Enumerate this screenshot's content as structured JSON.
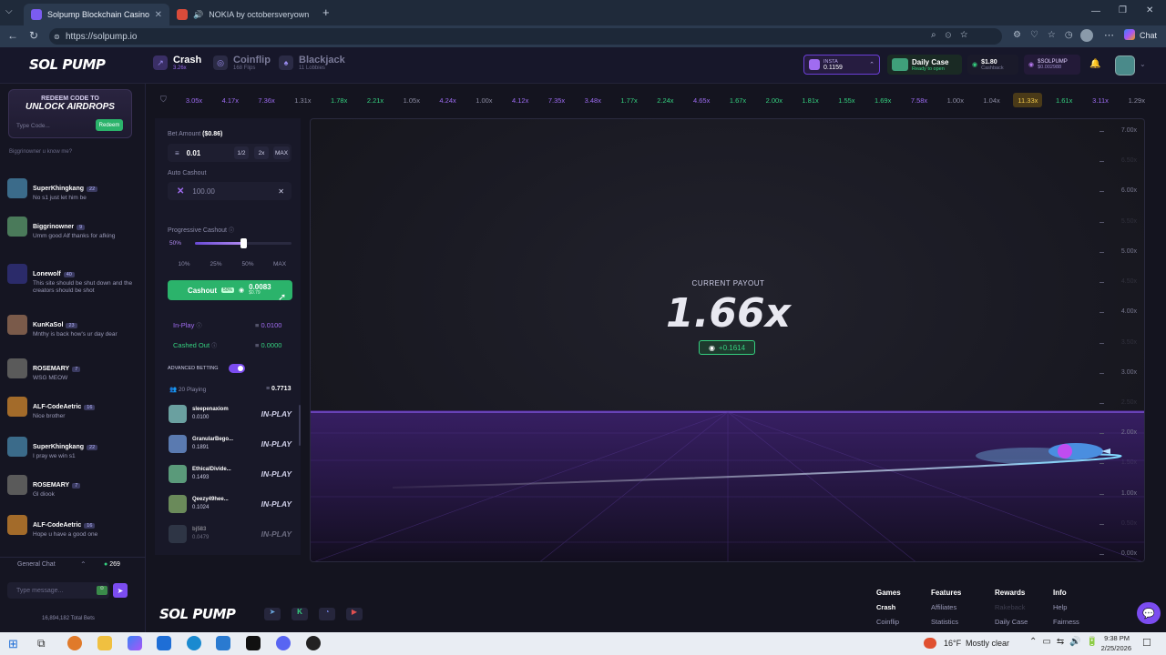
{
  "browser": {
    "tabs": [
      {
        "title": "Solpump Blockchain Casino | Sola",
        "active": true
      },
      {
        "title": "NOKIA by octobersveryown",
        "active": false
      }
    ],
    "new_tab": "+",
    "url": "https://solpump.io",
    "profile_label": "Chat"
  },
  "site": {
    "logo": "SOL PUMP",
    "games": [
      {
        "name": "Crash",
        "sub": "3.26x"
      },
      {
        "name": "Coinflip",
        "sub": "168 Flips"
      },
      {
        "name": "Blackjack",
        "sub": "11 Lobbies"
      }
    ],
    "header": {
      "insta_label": "INSTA",
      "insta_value": "0.1159",
      "daily_case_title": "Daily Case",
      "daily_case_sub": "Ready to open",
      "cashback_value": "$1.80",
      "cashback_label": "Cashback",
      "balance_label": "$SOLPUMP",
      "balance_value": "$0.002988"
    },
    "history": [
      "3.05x",
      "4.17x",
      "7.36x",
      "1.31x",
      "1.78x",
      "2.21x",
      "1.05x",
      "4.24x",
      "1.00x",
      "4.12x",
      "7.35x",
      "3.48x",
      "1.77x",
      "2.24x",
      "4.65x",
      "1.67x",
      "2.00x",
      "1.81x",
      "1.55x",
      "1.69x",
      "7.58x",
      "1.00x",
      "1.04x",
      "11.33x",
      "1.61x",
      "3.11x",
      "1.29x"
    ],
    "history_colors": [
      "#9d6cf2",
      "#9d6cf2",
      "#9d6cf2",
      "#8a8aa0",
      "#35d07f",
      "#35d07f",
      "#8a8aa0",
      "#9d6cf2",
      "#8a8aa0",
      "#9d6cf2",
      "#9d6cf2",
      "#9d6cf2",
      "#35d07f",
      "#35d07f",
      "#9d6cf2",
      "#35d07f",
      "#35d07f",
      "#35d07f",
      "#35d07f",
      "#35d07f",
      "#9d6cf2",
      "#8a8aa0",
      "#8a8aa0",
      "#f0c84a",
      "#35d07f",
      "#9d6cf2",
      "#8a8aa0"
    ]
  },
  "chat": {
    "redeem_title": "REDEEM CODE TO",
    "redeem_big": "UNLOCK AIRDROPS",
    "redeem_placeholder": "Type Code...",
    "redeem_button": "Redeem",
    "top_cut": "Biggrinowner u know me?",
    "messages": [
      {
        "name": "SuperKhingkang",
        "level": "22",
        "text": "No s1 just let him be",
        "color": "#3b6b8a"
      },
      {
        "name": "Biggrinowner",
        "level": "9",
        "text": "Umm good Alf thanks for afking",
        "color": "#4a7a5a"
      },
      {
        "name": "Lonewolf",
        "level": "40",
        "text": "This site should be shut down and the creators should be shot",
        "color": "#2b2b6a"
      },
      {
        "name": "KunKaSol",
        "level": "23",
        "text": "Mnthy is back how's ur day dear",
        "color": "#7a5a4a"
      },
      {
        "name": "ROSEMARY",
        "level": "7",
        "text": "WSG MEOW",
        "color": "#5a5a5a"
      },
      {
        "name": "ALF-CodeAetric",
        "level": "16",
        "text": "Nice brother",
        "color": "#a36b2a"
      },
      {
        "name": "SuperKhingkang",
        "level": "22",
        "text": "I pray we win s1",
        "color": "#3b6b8a"
      },
      {
        "name": "ROSEMARY",
        "level": "7",
        "text": "Gl diook",
        "color": "#5a5a5a"
      },
      {
        "name": "ALF-CodeAetric",
        "level": "16",
        "text": "Hope u have a good one",
        "color": "#a36b2a"
      }
    ],
    "channel": "General Chat",
    "online": "269",
    "input_placeholder": "Type message...",
    "total_bets": "16,894,182 Total Bets"
  },
  "bet": {
    "bet_amount_label": "Bet Amount",
    "bet_amount_usd": "($0.86)",
    "bet_amount": "0.01",
    "half": "1/2",
    "double": "2x",
    "max": "MAX",
    "auto_cashout_label": "Auto Cashout",
    "auto_cashout_value": "100.00",
    "progressive_label": "Progressive Cashout",
    "progressive_value": "50%",
    "progressive_fraction": 0.5,
    "presets": [
      "10%",
      "25%",
      "50%",
      "MAX"
    ],
    "cashout_label": "Cashout",
    "cashout_pct": "50%",
    "cashout_amount": "0.0083",
    "cashout_usd": "$0.79",
    "in_play_label": "In-Play",
    "in_play_value": "0.0100",
    "cashed_out_label": "Cashed Out",
    "cashed_out_value": "0.0000",
    "advanced_label": "ADVANCED BETTING",
    "playing_label": "20 Playing",
    "playing_total": "0.7713",
    "players": [
      {
        "name": "sleepenaxiom",
        "amount": "0.0100",
        "status": "IN-PLAY",
        "color": "#6aa0a0"
      },
      {
        "name": "GranularBego...",
        "amount": "0.1891",
        "status": "IN-PLAY",
        "color": "#5a7ab0"
      },
      {
        "name": "EthicalDivide...",
        "amount": "0.1493",
        "status": "IN-PLAY",
        "color": "#5a9a7a"
      },
      {
        "name": "Qeezy49hee...",
        "amount": "0.1024",
        "status": "IN-PLAY",
        "color": "#6a8a5a"
      },
      {
        "name": "bj583",
        "amount": "0.0479",
        "status": "IN-PLAY",
        "color": "#4a5a6a"
      }
    ]
  },
  "game": {
    "label": "CURRENT PAYOUT",
    "multiplier": "1.66x",
    "profit": "+0.1614",
    "y_ticks": [
      "7.00x",
      "6.50x",
      "6.00x",
      "5.50x",
      "5.00x",
      "4.50x",
      "4.00x",
      "3.50x",
      "3.00x",
      "2.50x",
      "2.00x",
      "1.50x",
      "1.00x",
      "0.50x",
      "0.00x"
    ]
  },
  "footer": {
    "logo": "SOL PUMP",
    "cols": [
      {
        "head": "Games",
        "items": [
          "Crash",
          "Coinflip"
        ]
      },
      {
        "head": "Features",
        "items": [
          "Affiliates",
          "Statistics"
        ]
      },
      {
        "head": "Rewards",
        "items": [
          "Rakeback",
          "Daily Case"
        ]
      },
      {
        "head": "Info",
        "items": [
          "Help",
          "Fairness"
        ]
      }
    ]
  },
  "taskbar": {
    "weather_temp": "16°F",
    "weather_text": "Mostly clear",
    "time": "9:38 PM",
    "date": "2/25/2026"
  }
}
